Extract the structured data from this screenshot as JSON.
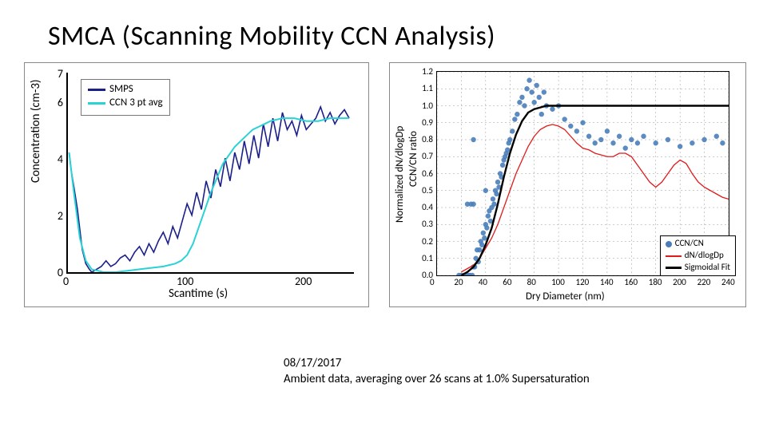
{
  "title": "SMCA (Scanning Mobility CCN Analysis)",
  "caption_line1": "08/17/2017",
  "caption_line2": "Ambient data, averaging over 26 scans at 1.0% Supersaturation",
  "chart_data": [
    {
      "type": "line",
      "title": "",
      "xlabel": "Scantime (s)",
      "ylabel": "Concentration (cm-3)",
      "xlim": [
        0,
        240
      ],
      "ylim": [
        0,
        7
      ],
      "xticks": [
        0,
        100,
        200
      ],
      "yticks": [
        0,
        2,
        4,
        6,
        7
      ],
      "series": [
        {
          "name": "SMPS",
          "color": "#1b1f8a",
          "x": [
            1,
            3,
            5,
            8,
            10,
            12,
            15,
            18,
            20,
            24,
            28,
            32,
            36,
            40,
            44,
            48,
            52,
            56,
            60,
            64,
            68,
            72,
            76,
            80,
            84,
            88,
            92,
            96,
            100,
            104,
            108,
            112,
            116,
            120,
            124,
            128,
            132,
            136,
            140,
            144,
            148,
            152,
            156,
            160,
            164,
            168,
            172,
            176,
            180,
            184,
            188,
            192,
            196,
            200,
            204,
            208,
            212,
            216,
            220,
            224,
            228,
            232,
            236
          ],
          "y": [
            4.2,
            3.5,
            3.0,
            2.2,
            1.5,
            0.8,
            0.3,
            0.1,
            0.0,
            0.1,
            0.2,
            0.4,
            0.2,
            0.3,
            0.5,
            0.6,
            0.4,
            0.7,
            0.9,
            0.6,
            1.0,
            0.7,
            1.1,
            1.4,
            1.0,
            1.6,
            1.2,
            1.8,
            2.4,
            2.0,
            2.8,
            2.2,
            3.2,
            2.6,
            3.6,
            3.0,
            4.0,
            3.2,
            4.2,
            3.6,
            4.6,
            3.8,
            4.8,
            4.0,
            5.2,
            4.4,
            5.4,
            4.6,
            5.6,
            5.0,
            5.3,
            4.8,
            5.5,
            5.0,
            5.2,
            5.4,
            5.8,
            5.3,
            5.6,
            5.2,
            5.5,
            5.7,
            5.4
          ]
        },
        {
          "name": "CCN 3 pt avg",
          "color": "#29d3d3",
          "x": [
            1,
            5,
            10,
            15,
            20,
            25,
            30,
            40,
            50,
            60,
            70,
            80,
            90,
            95,
            100,
            105,
            110,
            115,
            120,
            125,
            130,
            135,
            140,
            145,
            150,
            155,
            160,
            165,
            170,
            180,
            190,
            200,
            210,
            220,
            230,
            236
          ],
          "y": [
            4.2,
            2.8,
            1.2,
            0.4,
            0.1,
            0.05,
            0.0,
            0.0,
            0.05,
            0.1,
            0.15,
            0.2,
            0.3,
            0.4,
            0.6,
            1.0,
            1.6,
            2.2,
            2.8,
            3.3,
            3.8,
            4.1,
            4.4,
            4.6,
            4.8,
            5.0,
            5.1,
            5.2,
            5.3,
            5.4,
            5.4,
            5.3,
            5.3,
            5.4,
            5.4,
            5.4
          ]
        }
      ],
      "legend": [
        "SMPS",
        "CCN 3 pt avg"
      ]
    },
    {
      "type": "scatter+line",
      "title": "",
      "xlabel": "Dry Diameter (nm)",
      "ylabel_left": "CCN/CN ratio",
      "ylabel_right": "Normalized dN/dlogDp",
      "xlim": [
        0,
        240
      ],
      "ylim": [
        0,
        1.2
      ],
      "xticks": [
        0,
        20,
        40,
        60,
        80,
        100,
        120,
        140,
        160,
        180,
        200,
        220,
        240
      ],
      "yticks": [
        0.0,
        0.1,
        0.2,
        0.3,
        0.4,
        0.5,
        0.6,
        0.7,
        0.8,
        0.9,
        1.0,
        1.1,
        1.2
      ],
      "series": [
        {
          "name": "CCN/CN",
          "type": "scatter",
          "color": "#4a7ebb",
          "x": [
            18,
            20,
            22,
            24,
            25,
            26,
            27,
            28,
            29,
            30,
            30,
            30,
            31,
            32,
            33,
            34,
            35,
            36,
            37,
            38,
            39,
            40,
            40,
            41,
            42,
            43,
            44,
            45,
            46,
            47,
            48,
            49,
            50,
            51,
            52,
            53,
            54,
            55,
            56,
            57,
            58,
            59,
            60,
            62,
            64,
            66,
            68,
            70,
            72,
            74,
            76,
            78,
            80,
            82,
            84,
            86,
            88,
            90,
            95,
            100,
            105,
            110,
            115,
            120,
            125,
            130,
            135,
            140,
            145,
            150,
            155,
            160,
            165,
            170,
            180,
            190,
            200,
            210,
            220,
            230,
            235
          ],
          "y": [
            0.0,
            0.0,
            0.0,
            0.0,
            0.42,
            0.0,
            0.0,
            0.42,
            0.0,
            0.05,
            0.42,
            0.8,
            0.05,
            0.1,
            0.15,
            0.08,
            0.15,
            0.2,
            0.18,
            0.25,
            0.22,
            0.3,
            0.5,
            0.28,
            0.35,
            0.38,
            0.32,
            0.4,
            0.45,
            0.42,
            0.5,
            0.48,
            0.55,
            0.52,
            0.6,
            0.58,
            0.65,
            0.68,
            0.7,
            0.72,
            0.74,
            0.78,
            0.8,
            0.85,
            0.92,
            0.95,
            1.02,
            1.05,
            1.0,
            1.1,
            1.15,
            1.08,
            1.02,
            1.12,
            1.05,
            0.95,
            1.08,
            1.0,
            0.98,
            1.0,
            0.92,
            0.88,
            0.85,
            0.9,
            0.82,
            0.78,
            0.8,
            0.85,
            0.78,
            0.82,
            0.75,
            0.8,
            0.78,
            0.82,
            0.78,
            0.8,
            0.76,
            0.78,
            0.8,
            0.82,
            0.78
          ]
        },
        {
          "name": "dN/dlogDp",
          "type": "line",
          "color": "#e11b1b",
          "x": [
            20,
            25,
            30,
            35,
            40,
            45,
            50,
            55,
            60,
            65,
            70,
            75,
            80,
            85,
            90,
            95,
            100,
            105,
            110,
            115,
            120,
            125,
            130,
            135,
            140,
            145,
            150,
            155,
            160,
            165,
            170,
            175,
            180,
            185,
            190,
            195,
            200,
            205,
            210,
            215,
            220,
            225,
            230,
            235,
            240
          ],
          "y": [
            0.02,
            0.04,
            0.06,
            0.1,
            0.16,
            0.22,
            0.3,
            0.4,
            0.5,
            0.6,
            0.68,
            0.76,
            0.82,
            0.86,
            0.88,
            0.89,
            0.88,
            0.86,
            0.82,
            0.78,
            0.75,
            0.74,
            0.72,
            0.71,
            0.7,
            0.7,
            0.72,
            0.72,
            0.7,
            0.65,
            0.6,
            0.55,
            0.52,
            0.55,
            0.6,
            0.65,
            0.68,
            0.66,
            0.6,
            0.55,
            0.52,
            0.5,
            0.48,
            0.46,
            0.45
          ]
        },
        {
          "name": "Sigmoidal Fit",
          "type": "line",
          "color": "#000000",
          "x": [
            20,
            25,
            30,
            35,
            40,
            45,
            50,
            55,
            60,
            65,
            70,
            75,
            80,
            85,
            90,
            100,
            120,
            160,
            200,
            240
          ],
          "y": [
            0.0,
            0.02,
            0.05,
            0.1,
            0.18,
            0.28,
            0.42,
            0.58,
            0.72,
            0.83,
            0.91,
            0.96,
            0.98,
            0.99,
            1.0,
            1.0,
            1.0,
            1.0,
            1.0,
            1.0
          ]
        }
      ],
      "legend": [
        "CCN/CN",
        "dN/dlogDp",
        "Sigmoidal Fit"
      ]
    }
  ]
}
